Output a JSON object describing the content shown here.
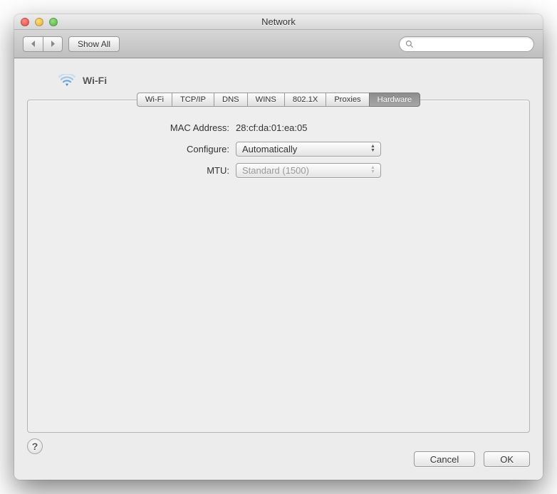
{
  "window": {
    "title": "Network"
  },
  "toolbar": {
    "show_all": "Show All",
    "search_placeholder": ""
  },
  "sheet": {
    "title": "Wi-Fi",
    "tabs": [
      "Wi-Fi",
      "TCP/IP",
      "DNS",
      "WINS",
      "802.1X",
      "Proxies",
      "Hardware"
    ],
    "active_tab": "Hardware"
  },
  "form": {
    "mac_label": "MAC Address:",
    "mac_value": "28:cf:da:01:ea:05",
    "configure_label": "Configure:",
    "configure_value": "Automatically",
    "mtu_label": "MTU:",
    "mtu_value": "Standard  (1500)"
  },
  "buttons": {
    "cancel": "Cancel",
    "ok": "OK",
    "help": "?"
  }
}
